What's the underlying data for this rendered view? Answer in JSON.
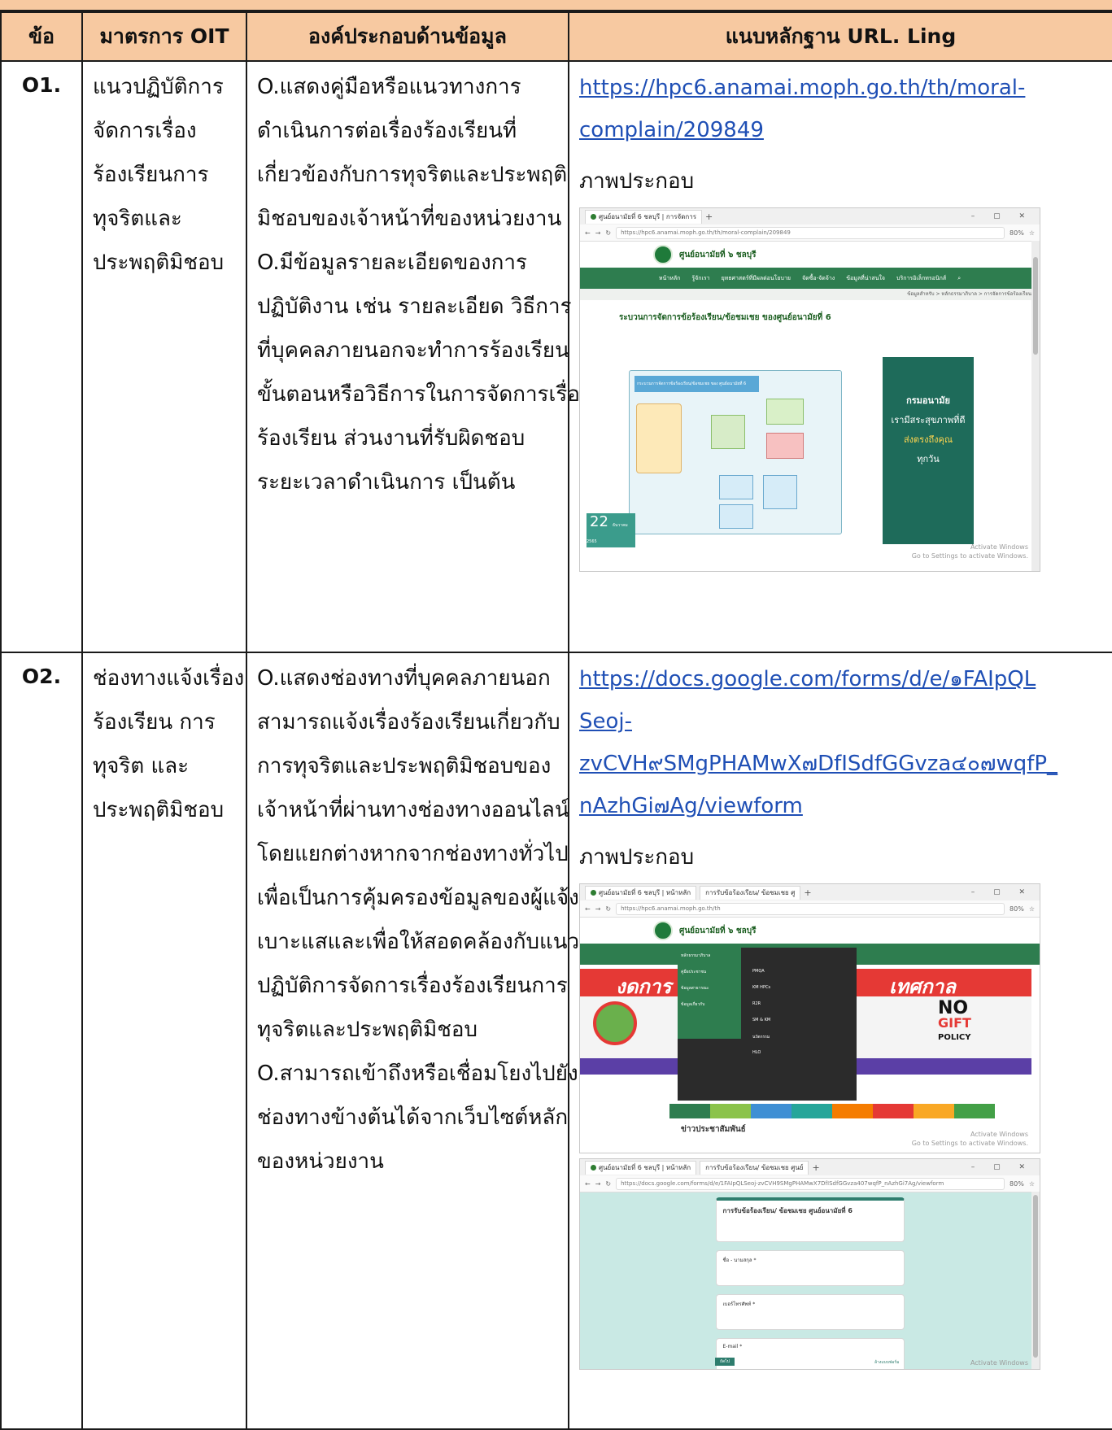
{
  "header": {
    "col_no": "ข้อ",
    "col_measure": "มาตรการ OIT",
    "col_info": "องค์ประกอบด้านข้อมูล",
    "col_evidence": "แนบหลักฐาน URL. Ling"
  },
  "rows": [
    {
      "no": "O1.",
      "measure_lines": [
        "แนวปฏิบัติการ",
        "จัดการเรื่อง",
        "ร้องเรียนการ",
        "ทุจริตและ",
        "ประพฤติมิชอบ"
      ],
      "info_lines": [
        "O.แสดงคู่มือหรือแนวทางการ",
        "ดำเนินการต่อเรื่องร้องเรียนที่",
        "เกี่ยวข้องกับการทุจริตและประพฤติ",
        "มิชอบของเจ้าหน้าที่ของหน่วยงาน",
        "O.มีข้อมูลรายละเอียดของการ",
        "ปฏิบัติงาน เช่น รายละเอียด วิธีการ",
        "ที่บุคคลภายนอกจะทำการร้องเรียน",
        "ขั้นตอนหรือวิธีการในการจัดการเรื่อง",
        "ร้องเรียน ส่วนงานที่รับผิดชอบ",
        "ระยะเวลาดำเนินการ เป็นต้น"
      ],
      "link_lines": [
        "https://hpc6.anamai.moph.go.th/th/moral-",
        "complain/209849"
      ],
      "illustration_label": "ภาพประกอบ",
      "screenshot": {
        "tab_title": "ศูนย์อนามัยที่ 6 ชลบุรี | การจัดการ",
        "url": "https://hpc6.anamai.moph.go.th/th/moral-complain/209849",
        "zoom": "80%",
        "site_name": "ศูนย์อนามัยที่ ๖ ชลบุรี",
        "nav_items": [
          "หน้าหลัก",
          "รู้จักเรา",
          "ยุทธศาสตร์ที่มีผลต่อนโยบาย",
          "จัดซื้อ-จัดจ้าง",
          "ข้อมูลที่น่าสนใจ",
          "บริการอิเล็กทรอนิกส์"
        ],
        "breadcrumb": "ข้อมูลสำหรับ > หลักธรรมาภิบาล > การจัดการข้อร้องเรียน",
        "page_title": "ระบวนการจัดการข้อร้องเรียน/ข้อชมเชย ของศูนย์อนามัยที่ 6",
        "flow_title": "กระบวนการจัดการข้อร้องเรียน/ข้อชมเชย ของ ศูนย์อนามัยที่ 6",
        "date_day": "22",
        "date_month": "ธันวาคม 2565",
        "banner_lines": [
          "กรมอนามัย",
          "เรามีสระสุขภาพที่ดี",
          "ส่งตรงถึงคุณ",
          "ทุกวัน"
        ],
        "activate_1": "Activate Windows",
        "activate_2": "Go to Settings to activate Windows.",
        "colors": {
          "nav_green": "#2e7d4f",
          "banner_teal": "#1e6b5a",
          "brand_green": "#1b5e20"
        }
      }
    },
    {
      "no": "O2.",
      "measure_lines": [
        "ช่องทางแจ้งเรื่อง",
        "ร้องเรียน การ",
        "ทุจริต และ",
        "ประพฤติมิชอบ"
      ],
      "info_lines": [
        "O.แสดงช่องทางที่บุคคลภายนอก",
        "สามารถแจ้งเรื่องร้องเรียนเกี่ยวกับ",
        "การทุจริตและประพฤติมิชอบของ",
        "เจ้าหน้าที่ผ่านทางช่องทางออนไลน์",
        "โดยแยกต่างหากจากช่องทางทั่วไป",
        "เพื่อเป็นการคุ้มครองข้อมูลของผู้แจ้ง",
        "เบาะแสและเพื่อให้สอดคล้องกับแนว",
        "ปฏิบัติการจัดการเรื่องร้องเรียนการ",
        "ทุจริตและประพฤติมิชอบ",
        "O.สามารถเข้าถึงหรือเชื่อมโยงไปยัง",
        "ช่องทางข้างต้นได้จากเว็บไซต์หลัก",
        "ของหน่วยงาน"
      ],
      "link_lines": [
        "https://docs.google.com/forms/d/e/๑FAIpQL",
        "Seoj-",
        "zvCVH๙SMgPHAMwX๗DfISdfGGvza๔๐๗wqfP_",
        "nAzhGi๗Ag/viewform"
      ],
      "illustration_label": "ภาพประกอบ",
      "screenshot_a": {
        "tab_title_1": "ศูนย์อนามัยที่ 6 ชลบุรี | หน้าหลัก",
        "tab_title_2": "การรับข้อร้องเรียน/ ข้อชมเชย ศู",
        "url": "https://hpc6.anamai.moph.go.th/th",
        "zoom": "80%",
        "site_name": "ศูนย์อนามัยที่ ๖ ชลบุรี",
        "banner_text_left": "งดการ",
        "banner_text_right": "เทศกาล",
        "no_gift": [
          "NO",
          "GIFT",
          "POLICY"
        ],
        "menu_items": [
          "หลักธรรมาภิบาล",
          "คู่มือประชาชน",
          "ข้อมูลสาธารณะ",
          "ข้อมูลเกี่ยวกับ",
          "PMQA",
          "KM HPCs",
          "R2R",
          "SM & KM",
          "นวัตกรรม",
          "HLO"
        ],
        "news_title": "ข่าวประชาสัมพันธ์",
        "activate_1": "Activate Windows",
        "activate_2": "Go to Settings to activate Windows.",
        "colors": {
          "nav_green": "#2e7d4f",
          "banner_red": "#e53935",
          "menu_dark": "#2b2b2b"
        }
      },
      "screenshot_b": {
        "tab_title_1": "ศูนย์อนามัยที่ 6 ชลบุรี | หน้าหลัก",
        "tab_title_2": "การรับข้อร้องเรียน/ ข้อชมเชย ศูนย์",
        "url": "https://docs.google.com/forms/d/e/1FAIpQLSeoj-zvCVH9SMgPHAMwX7DfISdfGGvza407wqfP_nAzhGi7Ag/viewform",
        "zoom": "80%",
        "form_title": "การรับข้อร้องเรียน/ ข้อชมเชย ศูนย์อนามัยที่ 6",
        "fields": [
          "ชื่อ - นามสกุล *",
          "เบอร์โทรศัพท์ *",
          "E-mail *"
        ],
        "submit": "ถัดไป",
        "clear": "ล้างแบบฟอร์ม",
        "activate_1": "Activate Windows",
        "colors": {
          "form_bg": "#c9e9e4"
        }
      }
    }
  ]
}
